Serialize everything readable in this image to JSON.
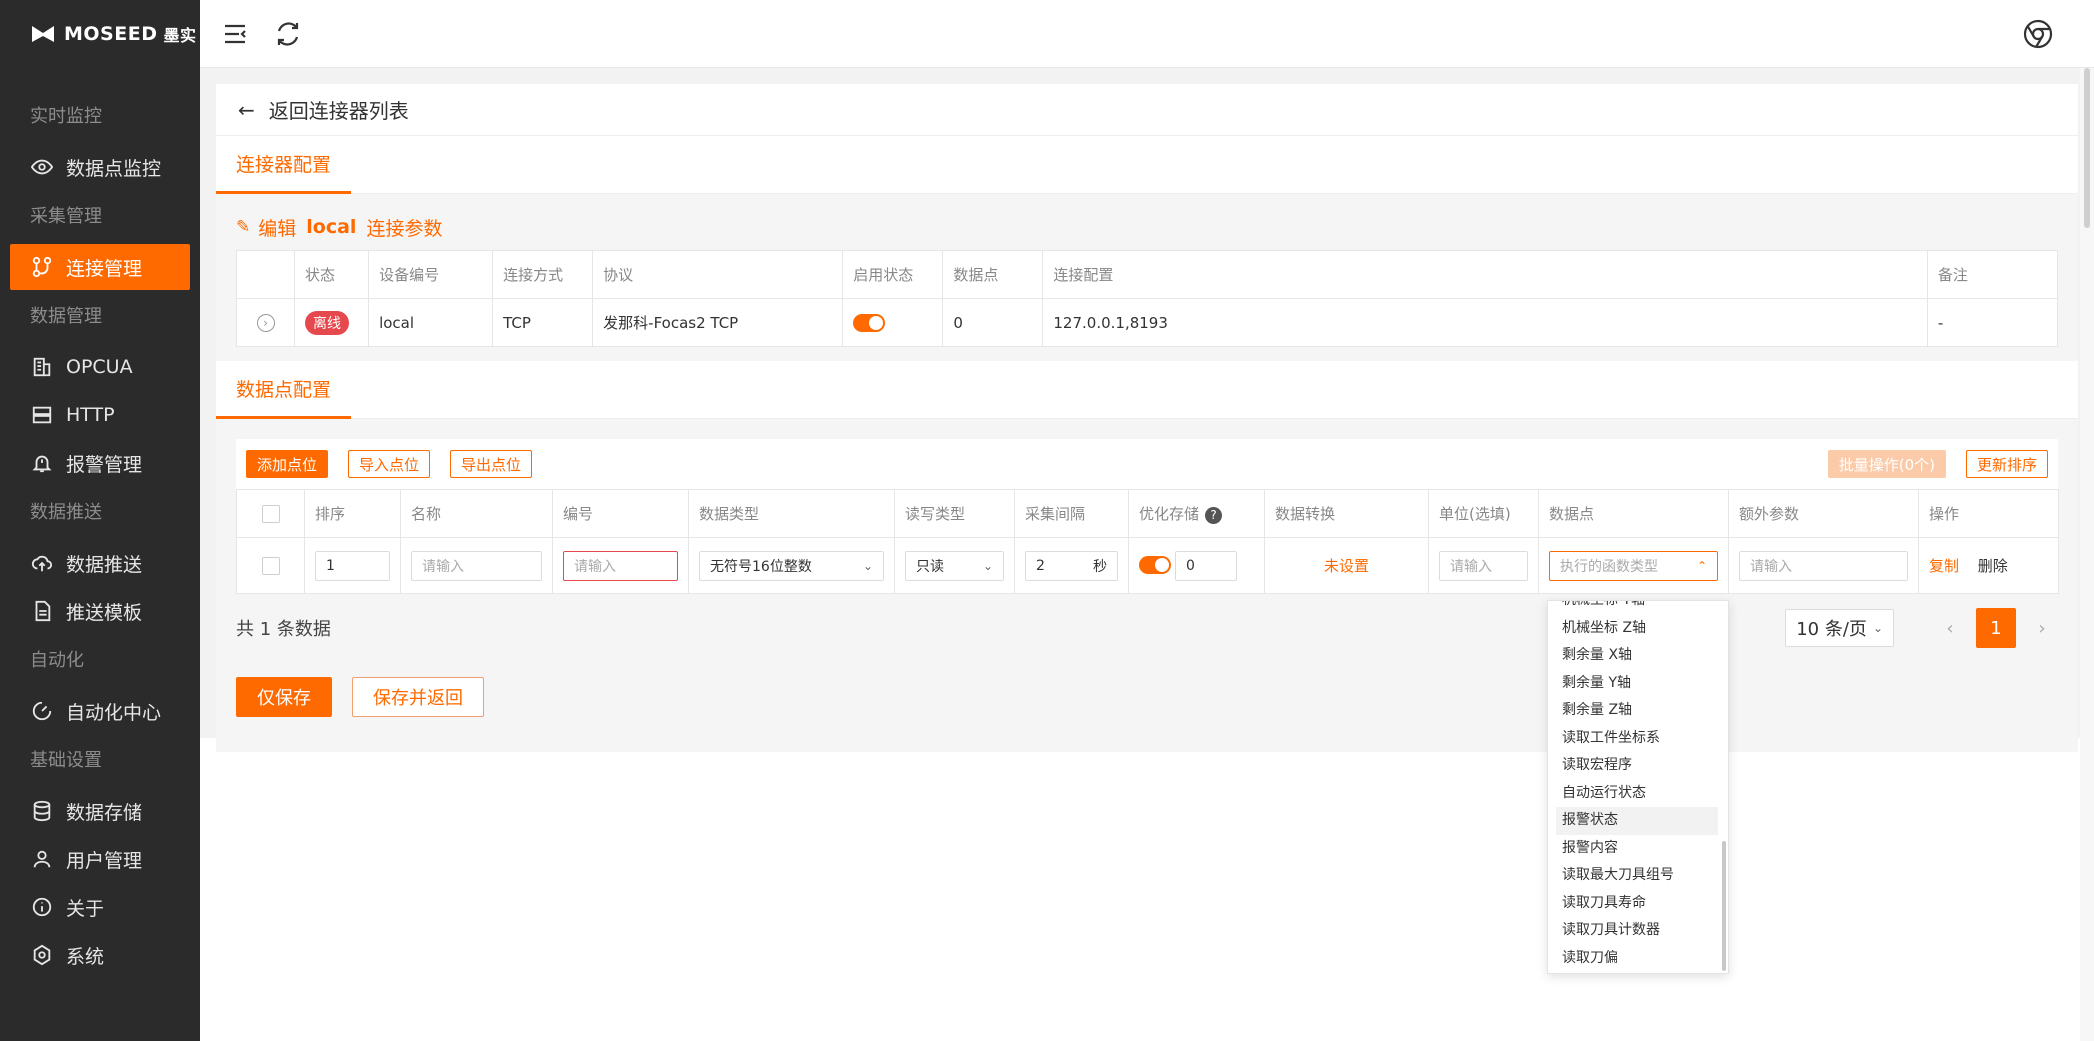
{
  "app": {
    "brand": "MOSEED",
    "brand_cn": "墨实"
  },
  "sidebar": {
    "groups": [
      {
        "title": "实时监控",
        "items": [
          {
            "label": "数据点监控",
            "icon": "eye-icon"
          }
        ]
      },
      {
        "title": "采集管理",
        "items": [
          {
            "label": "连接管理",
            "icon": "connection-icon",
            "active": true
          }
        ]
      },
      {
        "title": "数据管理",
        "items": [
          {
            "label": "OPCUA",
            "icon": "building-icon"
          },
          {
            "label": "HTTP",
            "icon": "server-icon"
          },
          {
            "label": "报警管理",
            "icon": "bell-icon"
          }
        ]
      },
      {
        "title": "数据推送",
        "items": [
          {
            "label": "数据推送",
            "icon": "cloud-upload-icon"
          },
          {
            "label": "推送模板",
            "icon": "document-icon"
          }
        ]
      },
      {
        "title": "自动化",
        "items": [
          {
            "label": "自动化中心",
            "icon": "gauge-icon"
          }
        ]
      },
      {
        "title": "基础设置",
        "items": [
          {
            "label": "数据存储",
            "icon": "database-icon"
          },
          {
            "label": "用户管理",
            "icon": "user-icon"
          },
          {
            "label": "关于",
            "icon": "info-icon"
          },
          {
            "label": "系统",
            "icon": "settings-icon"
          }
        ]
      }
    ]
  },
  "topbar": {
    "menu_icon": "menu-fold-icon",
    "refresh_icon": "refresh-icon",
    "browser_icon": "chrome-icon"
  },
  "back": {
    "label": "返回连接器列表"
  },
  "tab1": {
    "label": "连接器配置"
  },
  "edit": {
    "prefix": "编辑",
    "name": "local",
    "suffix": "连接参数"
  },
  "connector_table": {
    "headers": [
      "状态",
      "设备编号",
      "连接方式",
      "协议",
      "启用状态",
      "数据点",
      "连接配置",
      "备注"
    ],
    "row": {
      "status": "离线",
      "device": "local",
      "conn": "TCP",
      "protocol": "发那科-Focas2 TCP",
      "points": "0",
      "config": "127.0.0.1,8193",
      "remark": "-"
    }
  },
  "tab2": {
    "label": "数据点配置"
  },
  "toolbar": {
    "add": "添加点位",
    "import": "导入点位",
    "export": "导出点位",
    "batch": "批量操作(0个)",
    "reorder": "更新排序"
  },
  "points_table": {
    "headers": [
      "排序",
      "名称",
      "编号",
      "数据类型",
      "读写类型",
      "采集间隔",
      "优化存储",
      "数据转换",
      "单位(选填)",
      "数据点",
      "额外参数",
      "操作"
    ],
    "row": {
      "order": "1",
      "name_ph": "请输入",
      "code_ph": "请输入",
      "dtype": "无符号16位整数",
      "rw": "只读",
      "interval": "2",
      "interval_unit": "秒",
      "opt_value": "0",
      "convert": "未设置",
      "unit_ph": "请输入",
      "point_ph": "执行的函数类型",
      "extra_ph": "请输入",
      "copy": "复制",
      "delete": "删除"
    }
  },
  "footer": {
    "count": "共 1 条数据",
    "page_size": "10 条/页",
    "page": "1",
    "prev": "‹",
    "next": "›"
  },
  "actions": {
    "save": "仅保存",
    "save_back": "保存并返回"
  },
  "dropdown": {
    "cut_item": "机械坐标 Y轴",
    "items": [
      "机械坐标 Z轴",
      "剩余量 X轴",
      "剩余量 Y轴",
      "剩余量 Z轴",
      "读取工件坐标系",
      "读取宏程序",
      "自动运行状态",
      "报警状态",
      "报警内容",
      "读取最大刀具组号",
      "读取刀具寿命",
      "读取刀具计数器",
      "读取刀偏"
    ],
    "hover_index": 7
  },
  "colors": {
    "accent": "#ff6a00",
    "sidebar_bg": "#2b2b2b",
    "danger": "#e5484d"
  }
}
